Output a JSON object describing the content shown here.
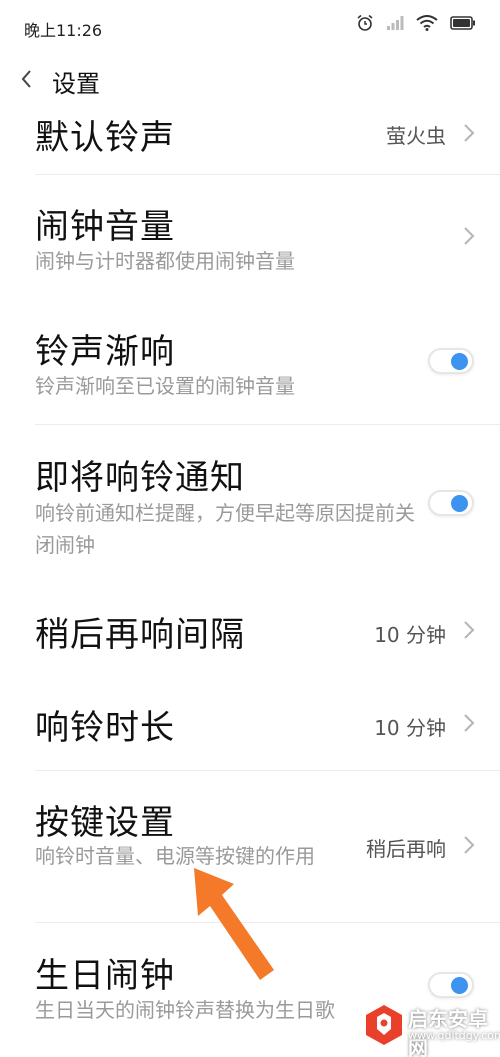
{
  "status_bar": {
    "time": "晚上11:26",
    "icons": [
      "alarm-icon",
      "signal-icon",
      "wifi-icon",
      "battery-icon"
    ]
  },
  "header": {
    "title": "设置",
    "back_icon": "back-chevron-icon"
  },
  "rows": [
    {
      "id": "default-ringtone",
      "title": "默认铃声",
      "value": "萤火虫",
      "chevron": true
    },
    {
      "id": "alarm-volume",
      "title": "闹钟音量",
      "subtitle": "闹钟与计时器都使用闹钟音量",
      "chevron": true
    },
    {
      "id": "gradual-ring",
      "title": "铃声渐响",
      "subtitle": "铃声渐响至已设置的闹钟音量",
      "toggle": true
    },
    {
      "id": "upcoming-notice",
      "title": "即将响铃通知",
      "subtitle": "响铃前通知栏提醒，方便早起等原因提前关闭闹钟",
      "toggle": true
    },
    {
      "id": "snooze-interval",
      "title": "稍后再响间隔",
      "value": "10 分钟",
      "chevron": true
    },
    {
      "id": "ring-duration",
      "title": "响铃时长",
      "value": "10 分钟",
      "chevron": true
    },
    {
      "id": "button-settings",
      "title": "按键设置",
      "subtitle": "响铃时音量、电源等按键的作用",
      "value": "稍后再响",
      "chevron": true
    },
    {
      "id": "birthday-alarm",
      "title": "生日闹钟",
      "subtitle": "生日当天的闹钟铃声替换为生日歌",
      "toggle": true
    }
  ],
  "colors": {
    "toggle_on": "#3c93f0",
    "annotation_arrow": "#f47a2a",
    "watermark_red": "#e8402a"
  },
  "watermark": {
    "name": "启东安卓网",
    "url": "www.qdltdgy.com"
  }
}
